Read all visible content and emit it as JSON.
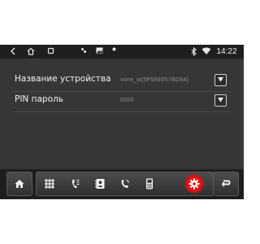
{
  "status_bar": {
    "time": "14:22",
    "icons": [
      "back-icon",
      "home-icon",
      "recents-icon",
      "dots-icon",
      "image-icon",
      "notification-icon",
      "bluetooth-icon",
      "wifi-icon"
    ]
  },
  "settings": [
    {
      "label": "Название устройства",
      "value": "vomi_st(5F5590S7BD54)",
      "control": "dropdown-arrow-icon"
    },
    {
      "label": "PIN пароль",
      "value": "0000",
      "control": "dropdown-arrow-icon"
    }
  ],
  "nav_bar": {
    "buttons": [
      "home-icon",
      "keypad-icon",
      "phone-log-icon",
      "contacts-icon",
      "call-icon",
      "device-phone-icon",
      "settings-gear-icon",
      "back-arrow-icon"
    ],
    "active": "settings-gear-icon",
    "active_color": "#e01010"
  }
}
